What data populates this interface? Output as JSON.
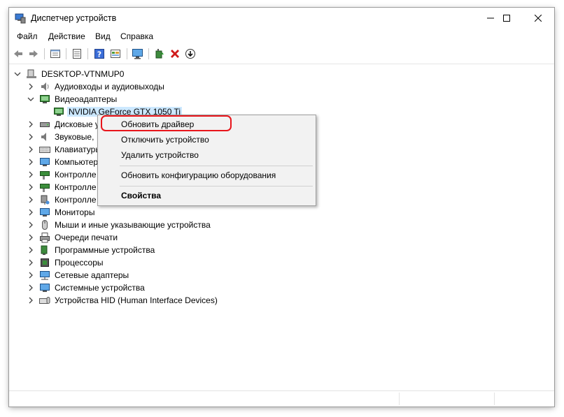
{
  "window": {
    "title": "Диспетчер устройств",
    "title_icon": "device-manager-icon"
  },
  "menu": {
    "items": [
      "Файл",
      "Действие",
      "Вид",
      "Справка"
    ]
  },
  "toolbar": {
    "icons": [
      "back-arrow-icon",
      "forward-arrow-icon",
      "properties-view-icon",
      "list-view-icon",
      "help-icon",
      "resources-view-icon",
      "monitor-scan-icon",
      "update-driver-icon",
      "uninstall-x-icon",
      "download-icon"
    ]
  },
  "tree": {
    "root": "DESKTOP-VTNMUP0",
    "items": [
      {
        "label": "Аудиовходы и аудиовыходы",
        "expanded": false
      },
      {
        "label": "Видеоадаптеры",
        "expanded": true
      },
      {
        "label": "NVIDIA GeForce GTX 1050 Ti",
        "child": true,
        "selected": true
      },
      {
        "label": "Дисковые у",
        "expanded": false
      },
      {
        "label": "Звуковые,",
        "expanded": false
      },
      {
        "label": "Клавиатуры",
        "expanded": false
      },
      {
        "label": "Компьютер",
        "expanded": false
      },
      {
        "label": "Контролле",
        "expanded": false
      },
      {
        "label": "Контролле",
        "expanded": false
      },
      {
        "label": "Контролле",
        "expanded": false
      },
      {
        "label": "Мониторы",
        "expanded": false
      },
      {
        "label": "Мыши и иные указывающие устройства",
        "expanded": false
      },
      {
        "label": "Очереди печати",
        "expanded": false
      },
      {
        "label": "Программные устройства",
        "expanded": false
      },
      {
        "label": "Процессоры",
        "expanded": false
      },
      {
        "label": "Сетевые адаптеры",
        "expanded": false
      },
      {
        "label": "Системные устройства",
        "expanded": false
      },
      {
        "label": "Устройства HID (Human Interface Devices)",
        "expanded": false
      }
    ]
  },
  "context_menu": {
    "update_driver": "Обновить драйвер",
    "disable_device": "Отключить устройство",
    "uninstall_device": "Удалить устройство",
    "scan_hardware": "Обновить конфигурацию оборудования",
    "properties": "Свойства"
  },
  "colors": {
    "highlight_border": "#e8151b",
    "selection_bg": "#cce8ff"
  }
}
